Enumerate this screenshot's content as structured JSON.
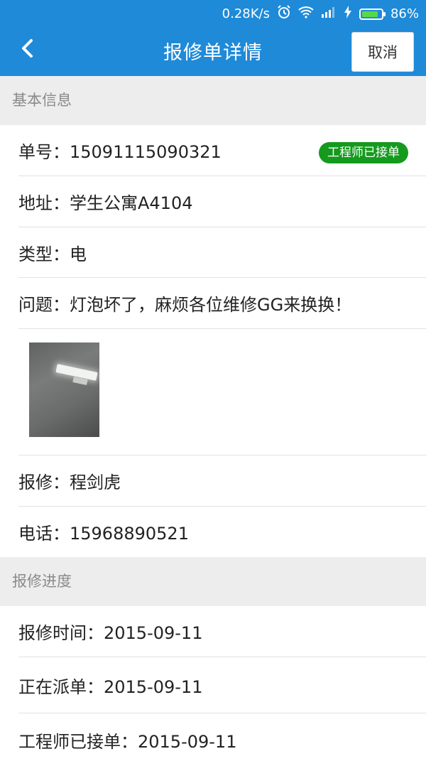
{
  "status_bar": {
    "speed": "0.28K/s",
    "battery": "86%",
    "battery_level": 0.86,
    "icons": [
      "alarm-icon",
      "wifi-icon",
      "signal-icon",
      "charging-icon",
      "battery-icon"
    ]
  },
  "header": {
    "title": "报修单详情",
    "back_icon": "chevron-left-icon",
    "cancel_label": "取消",
    "color": "#1f8ad8"
  },
  "basic_info": {
    "section_title": "基本信息",
    "order_no": "单号：15091115090321",
    "status_badge": "工程师已接单",
    "status_color": "#159a1e",
    "address": "地址：学生公寓A4104",
    "type": "类型：电",
    "problem": "问题：灯泡坏了，麻烦各位维修GG来换换！",
    "reporter": "报修：程剑虎",
    "phone": "电话：15968890521"
  },
  "progress": {
    "section_title": "报修进度",
    "items": [
      "报修时间：2015-09-11",
      "正在派单：2015-09-11",
      "工程师已接单：2015-09-11"
    ]
  }
}
